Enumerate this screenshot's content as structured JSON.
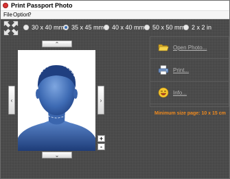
{
  "window": {
    "title": "Print Passport Photo"
  },
  "menu": [
    "File",
    "Option",
    "?"
  ],
  "sizes": [
    {
      "label": "30 x 40 mm",
      "selected": false
    },
    {
      "label": "35 x 45 mm",
      "selected": true
    },
    {
      "label": "40 x 40 mm",
      "selected": false
    },
    {
      "label": "50 x 50 mm",
      "selected": false
    },
    {
      "label": "2 x 2 in",
      "selected": false
    }
  ],
  "nudge": {
    "up": "⌃",
    "down": "⌄",
    "left": "‹",
    "right": "›"
  },
  "zoom": {
    "in": "+",
    "out": "-"
  },
  "actions": [
    {
      "label": "Open Photo...",
      "icon": "folder-icon"
    },
    {
      "label": "Print...",
      "icon": "printer-icon"
    },
    {
      "label": "Info...",
      "icon": "smiley-icon"
    }
  ],
  "min_size_text": "Minimum size page: 10 x 15 cm",
  "colors": {
    "accent": "#f08a1e",
    "background": "#484848",
    "silhouette": "#3d6ab3"
  }
}
